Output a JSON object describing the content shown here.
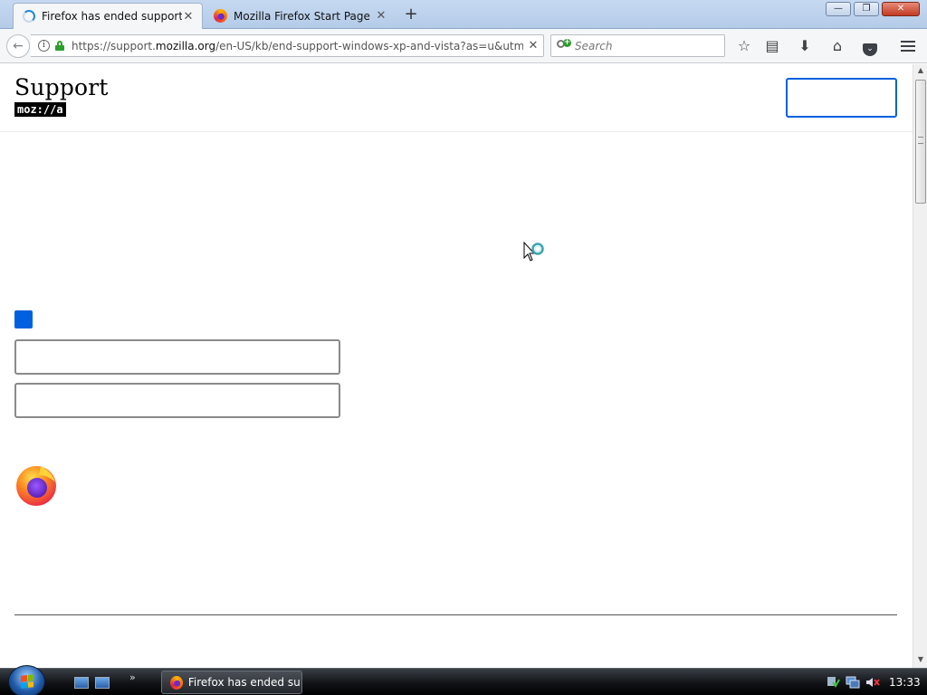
{
  "browser": {
    "tabs": [
      {
        "label": "Firefox has ended support f...",
        "active": true
      },
      {
        "label": "Mozilla Firefox Start Page",
        "active": false
      }
    ],
    "new_tab": "+",
    "window_controls": {
      "minimize": "—",
      "restore": "❐",
      "close": "✕"
    },
    "url": {
      "prefix": "https://support.",
      "domain": "mozilla.org",
      "path": "/en-US/kb/end-support-windows-xp-and-vista?as=u&utm"
    },
    "search": {
      "placeholder": "Search"
    },
    "toolbar_icons": [
      "bookmark-star-icon",
      "reading-list-icon",
      "download-icon",
      "home-icon",
      "pocket-icon",
      "menu-icon"
    ]
  },
  "page": {
    "brand_title": "Support",
    "brand_logo": "moz://a",
    "accent_color": "#0060df"
  },
  "taskbar": {
    "task_label": "Firefox has ended su...",
    "more": "»",
    "clock": "13:33"
  }
}
